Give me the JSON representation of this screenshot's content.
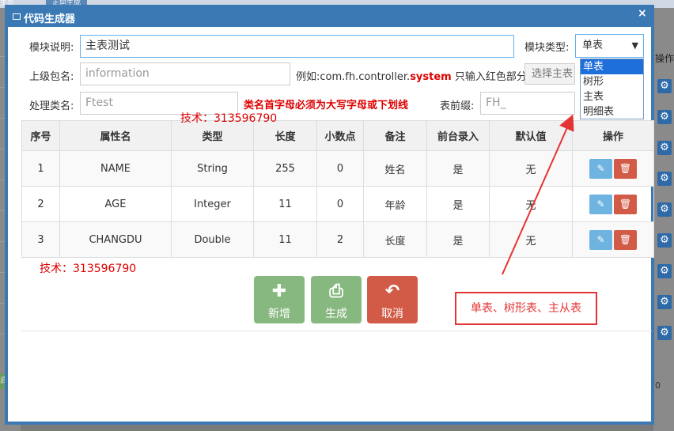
{
  "background": {
    "tab_left": "主页",
    "tab_active": "正向生成",
    "left_button": "启动",
    "right_header": "操作",
    "right_number": "0"
  },
  "dialog": {
    "title": "代码生成器",
    "close": "×"
  },
  "form": {
    "module_desc_label": "模块说明:",
    "module_desc_value": "主表测试",
    "module_type_label": "模块类型:",
    "module_type_value": "单表",
    "module_type_options": [
      "单表",
      "树形",
      "主表",
      "明细表"
    ],
    "package_label": "上级包名:",
    "package_placeholder": "information",
    "package_hint_prefix": "例如:com.fh.controller.",
    "package_hint_red": "system",
    "package_hint_suffix": " 只输入红色部分",
    "select_table_button": "选择主表",
    "class_label": "处理类名:",
    "class_placeholder": "Ftest",
    "class_warning": "类名首字母必须为大写字母或下划线",
    "prefix_label": "表前缀:",
    "prefix_placeholder": "FH_"
  },
  "table": {
    "headers": [
      "序号",
      "属性名",
      "类型",
      "长度",
      "小数点",
      "备注",
      "前台录入",
      "默认值",
      "操作"
    ],
    "rows": [
      [
        "1",
        "NAME",
        "String",
        "255",
        "0",
        "姓名",
        "是",
        "无"
      ],
      [
        "2",
        "AGE",
        "Integer",
        "11",
        "0",
        "年龄",
        "是",
        "无"
      ],
      [
        "3",
        "CHANGDU",
        "Double",
        "11",
        "2",
        "长度",
        "是",
        "无"
      ]
    ]
  },
  "watermarks": {
    "tech_top": "技术：313596790",
    "tech_bottom": "技术：313596790"
  },
  "buttons": {
    "add": "新增",
    "generate": "生成",
    "cancel": "取消"
  },
  "annotation": {
    "callout": "单表、树形表、主从表"
  },
  "colors": {
    "primary": "#3b79b5",
    "success": "#87b87f",
    "danger": "#d15b47",
    "info": "#6fb3e0",
    "annotation_red": "#e53333"
  },
  "icons": {
    "add": "plus-icon",
    "generate": "printer-icon",
    "cancel": "undo-icon",
    "edit": "pencil-icon",
    "delete": "trash-icon",
    "gear": "gear-icon"
  }
}
